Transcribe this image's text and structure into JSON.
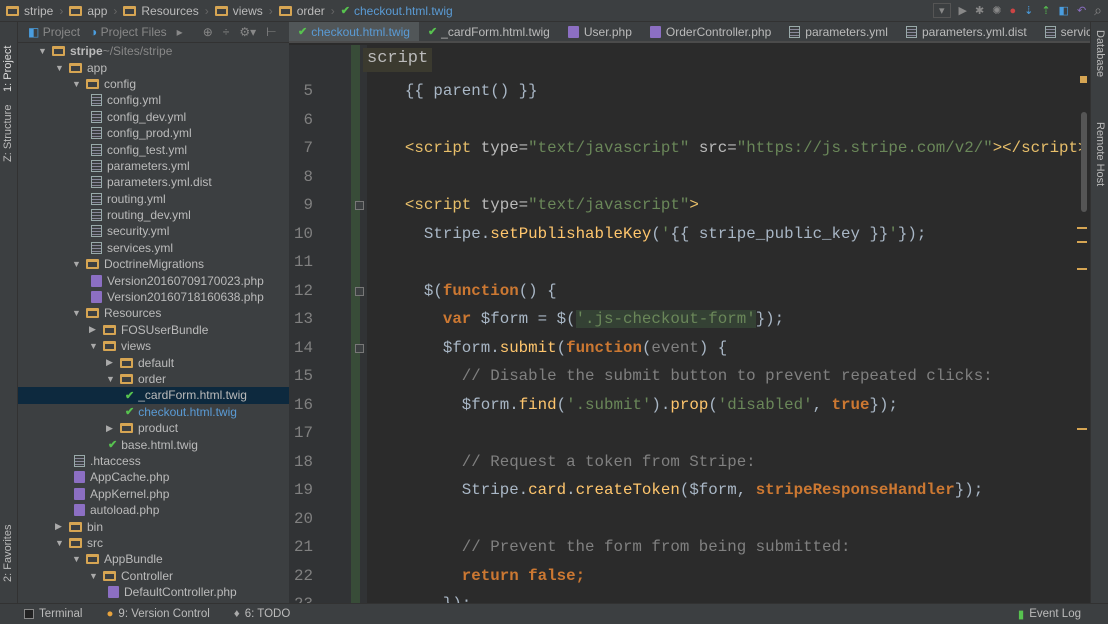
{
  "navbar": {
    "crumbs": [
      "stripe",
      "app",
      "Resources",
      "views",
      "order"
    ],
    "file": "checkout.html.twig"
  },
  "left_strip": {
    "project": "1: Project",
    "structure": "Z: Structure",
    "favorites": "2: Favorites"
  },
  "right_strip": {
    "database": "Database",
    "remote": "Remote Host"
  },
  "project_toolbar": {
    "project": "Project",
    "files": "Project Files"
  },
  "tree": [
    {
      "l": 0,
      "t": "folder",
      "open": true,
      "name": "stripe",
      "extra": " ~/Sites/stripe"
    },
    {
      "l": 1,
      "t": "folder",
      "open": true,
      "name": "app"
    },
    {
      "l": 2,
      "t": "folder",
      "open": true,
      "name": "config"
    },
    {
      "l": 3,
      "t": "yml",
      "name": "config.yml"
    },
    {
      "l": 3,
      "t": "yml",
      "name": "config_dev.yml"
    },
    {
      "l": 3,
      "t": "yml",
      "name": "config_prod.yml"
    },
    {
      "l": 3,
      "t": "yml",
      "name": "config_test.yml"
    },
    {
      "l": 3,
      "t": "yml",
      "name": "parameters.yml"
    },
    {
      "l": 3,
      "t": "yml",
      "name": "parameters.yml.dist"
    },
    {
      "l": 3,
      "t": "yml",
      "name": "routing.yml"
    },
    {
      "l": 3,
      "t": "yml",
      "name": "routing_dev.yml"
    },
    {
      "l": 3,
      "t": "yml",
      "name": "security.yml"
    },
    {
      "l": 3,
      "t": "yml",
      "name": "services.yml"
    },
    {
      "l": 2,
      "t": "folder",
      "open": true,
      "name": "DoctrineMigrations"
    },
    {
      "l": 3,
      "t": "php",
      "name": "Version20160709170023.php"
    },
    {
      "l": 3,
      "t": "php",
      "name": "Version20160718160638.php"
    },
    {
      "l": 2,
      "t": "folder",
      "open": true,
      "name": "Resources"
    },
    {
      "l": 3,
      "t": "folder",
      "open": false,
      "name": "FOSUserBundle"
    },
    {
      "l": 3,
      "t": "folder",
      "open": true,
      "name": "views"
    },
    {
      "l": 4,
      "t": "folder",
      "open": false,
      "name": "default"
    },
    {
      "l": 4,
      "t": "folder",
      "open": true,
      "name": "order"
    },
    {
      "l": 5,
      "t": "twig",
      "name": "_cardForm.html.twig",
      "sel": true
    },
    {
      "l": 5,
      "t": "twig",
      "name": "checkout.html.twig",
      "blue": true
    },
    {
      "l": 4,
      "t": "folder",
      "open": false,
      "name": "product"
    },
    {
      "l": 4,
      "t": "twig",
      "name": "base.html.twig"
    },
    {
      "l": 2,
      "t": "yml",
      "name": ".htaccess"
    },
    {
      "l": 2,
      "t": "php",
      "name": "AppCache.php"
    },
    {
      "l": 2,
      "t": "php",
      "name": "AppKernel.php"
    },
    {
      "l": 2,
      "t": "php",
      "name": "autoload.php"
    },
    {
      "l": 1,
      "t": "folder",
      "open": false,
      "name": "bin"
    },
    {
      "l": 1,
      "t": "folder",
      "open": true,
      "name": "src"
    },
    {
      "l": 2,
      "t": "folder",
      "open": true,
      "name": "AppBundle"
    },
    {
      "l": 3,
      "t": "folder",
      "open": true,
      "name": "Controller"
    },
    {
      "l": 4,
      "t": "php",
      "name": "DefaultController.php"
    }
  ],
  "tabs": [
    {
      "name": "checkout.html.twig",
      "t": "twig",
      "active": true
    },
    {
      "name": "_cardForm.html.twig",
      "t": "twig"
    },
    {
      "name": "User.php",
      "t": "php"
    },
    {
      "name": "OrderController.php",
      "t": "php"
    },
    {
      "name": "parameters.yml",
      "t": "yml"
    },
    {
      "name": "parameters.yml.dist",
      "t": "yml"
    },
    {
      "name": "services.yml",
      "t": "yml"
    }
  ],
  "tabs_overflow": "≡1",
  "editor_breadcrumb": "script",
  "code": [
    {
      "n": "5",
      "seg": [
        [
          "",
          "    {{ parent() }}"
        ]
      ]
    },
    {
      "n": "6",
      "seg": []
    },
    {
      "n": "7",
      "seg": [
        [
          "",
          "    "
        ],
        [
          "tg",
          "<script "
        ],
        [
          "at",
          "type="
        ],
        [
          "s",
          "\"text/javascript\" "
        ],
        [
          "at",
          "src="
        ],
        [
          "s",
          "\"https://js.stripe.com/v2/\""
        ],
        [
          "tg",
          "></script>"
        ]
      ]
    },
    {
      "n": "8",
      "seg": []
    },
    {
      "n": "9",
      "seg": [
        [
          "",
          "    "
        ],
        [
          "tg",
          "<script "
        ],
        [
          "at",
          "type="
        ],
        [
          "s",
          "\"text/javascript\""
        ],
        [
          "tg",
          ">"
        ]
      ]
    },
    {
      "n": "10",
      "seg": [
        [
          "",
          "      Stripe."
        ],
        [
          "f",
          "setPublishableKey"
        ],
        [
          "",
          "("
        ],
        [
          "s",
          "'"
        ],
        [
          "",
          "{{ stripe_public_key }}"
        ],
        [
          "s",
          "'"
        ],
        [
          "",
          "});"
        ]
      ]
    },
    {
      "n": "11",
      "seg": []
    },
    {
      "n": "12",
      "seg": [
        [
          "",
          "      $("
        ],
        [
          "k",
          "function"
        ],
        [
          "",
          "() {"
        ]
      ]
    },
    {
      "n": "13",
      "seg": [
        [
          "",
          "        "
        ],
        [
          "k",
          "var "
        ],
        [
          "",
          "$form = $("
        ],
        [
          "s hl",
          "'.js-checkout-form'"
        ],
        [
          "",
          "});"
        ]
      ]
    },
    {
      "n": "14",
      "seg": [
        [
          "",
          "        $form."
        ],
        [
          "f",
          "submit"
        ],
        [
          "",
          "("
        ],
        [
          "k",
          "function"
        ],
        [
          "",
          "("
        ],
        [
          "p",
          "event"
        ],
        [
          "",
          ") {"
        ]
      ]
    },
    {
      "n": "15",
      "seg": [
        [
          "",
          "          "
        ],
        [
          "c",
          "// Disable the submit button to prevent repeated clicks:"
        ]
      ]
    },
    {
      "n": "16",
      "seg": [
        [
          "",
          "          $form."
        ],
        [
          "f",
          "find"
        ],
        [
          "",
          "("
        ],
        [
          "s",
          "'.submit'"
        ],
        [
          "",
          ")."
        ],
        [
          "f",
          "prop"
        ],
        [
          "",
          "("
        ],
        [
          "s",
          "'disabled'"
        ],
        [
          "",
          ", "
        ],
        [
          "k",
          "true"
        ],
        [
          "",
          "});"
        ]
      ]
    },
    {
      "n": "17",
      "seg": []
    },
    {
      "n": "18",
      "seg": [
        [
          "",
          "          "
        ],
        [
          "c",
          "// Request a token from Stripe:"
        ]
      ]
    },
    {
      "n": "19",
      "seg": [
        [
          "",
          "          Stripe."
        ],
        [
          "f",
          "card"
        ],
        [
          "",
          "."
        ],
        [
          "f",
          "createToken"
        ],
        [
          "",
          "($form, "
        ],
        [
          "k",
          "stripeResponseHandler"
        ],
        [
          "",
          "});"
        ]
      ]
    },
    {
      "n": "20",
      "seg": []
    },
    {
      "n": "21",
      "seg": [
        [
          "",
          "          "
        ],
        [
          "c",
          "// Prevent the form from being submitted:"
        ]
      ]
    },
    {
      "n": "22",
      "seg": [
        [
          "",
          "          "
        ],
        [
          "k",
          "return false"
        ],
        [
          "k",
          ";"
        ]
      ]
    },
    {
      "n": "23",
      "seg": [
        [
          "",
          "        });"
        ]
      ]
    }
  ],
  "status": {
    "terminal": "Terminal",
    "vcs": "9: Version Control",
    "todo": "6: TODO",
    "event_log": "Event Log"
  },
  "colors": {
    "bg": "#2b2b2b",
    "panel": "#3c3f41",
    "keyword": "#cc7832",
    "string": "#6a8759",
    "tag": "#e8bf6a",
    "selection": "#0d293e",
    "twig": "#57c24f"
  }
}
